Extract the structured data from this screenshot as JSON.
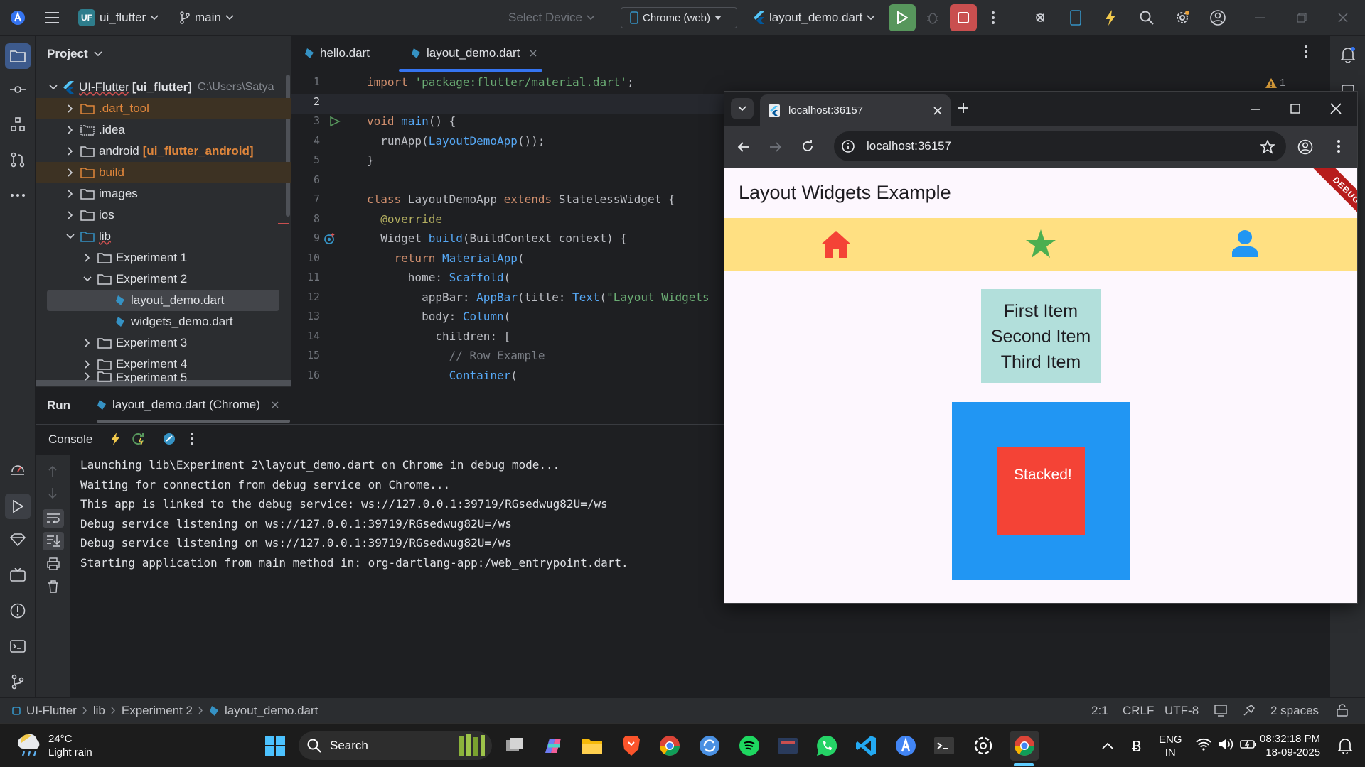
{
  "topbar": {
    "project_badge": "UF",
    "project_name": "ui_flutter",
    "branch": "main",
    "device_placeholder": "Select Device",
    "device_selected": "Chrome (web)",
    "run_config": "layout_demo.dart"
  },
  "project_panel": {
    "title": "Project",
    "root_name": "UI-Flutter",
    "root_module": "[ui_flutter]",
    "root_path": "C:\\Users\\Satya",
    "items": [
      {
        "label": ".dart_tool",
        "suffix": ""
      },
      {
        "label": ".idea",
        "suffix": ""
      },
      {
        "label": "android",
        "suffix": "[ui_flutter_android]"
      },
      {
        "label": "build",
        "suffix": ""
      },
      {
        "label": "images",
        "suffix": ""
      },
      {
        "label": "ios",
        "suffix": ""
      },
      {
        "label": "lib",
        "suffix": ""
      },
      {
        "label": "Experiment 1",
        "suffix": ""
      },
      {
        "label": "Experiment 2",
        "suffix": ""
      },
      {
        "label": "layout_demo.dart",
        "suffix": ""
      },
      {
        "label": "widgets_demo.dart",
        "suffix": ""
      },
      {
        "label": "Experiment 3",
        "suffix": ""
      },
      {
        "label": "Experiment 4",
        "suffix": ""
      },
      {
        "label": "Experiment 5",
        "suffix": ""
      }
    ]
  },
  "editor": {
    "tabs": [
      {
        "label": "hello.dart"
      },
      {
        "label": "layout_demo.dart"
      }
    ],
    "warning_count": "1",
    "line_numbers": [
      "1",
      "2",
      "3",
      "4",
      "5",
      "6",
      "7",
      "8",
      "9",
      "10",
      "11",
      "12",
      "13",
      "14",
      "15",
      "16"
    ],
    "lines": [
      "import 'package:flutter/material.dart';",
      "",
      "void main() {",
      "  runApp(LayoutDemoApp());",
      "}",
      "",
      "class LayoutDemoApp extends StatelessWidget {",
      "  @override",
      "  Widget build(BuildContext context) {",
      "    return MaterialApp(",
      "      home: Scaffold(",
      "        appBar: AppBar(title: Text(\"Layout Widgets",
      "        body: Column(",
      "          children: [",
      "            // Row Example",
      "            Container("
    ]
  },
  "run_panel": {
    "tab_run": "Run",
    "tab_config": "layout_demo.dart (Chrome)",
    "console_label": "Console",
    "console_lines": [
      "Launching lib\\Experiment 2\\layout_demo.dart on Chrome in debug mode...",
      "Waiting for connection from debug service on Chrome...",
      "This app is linked to the debug service: ws://127.0.0.1:39719/RGsedwug82U=/ws",
      "Debug service listening on ws://127.0.0.1:39719/RGsedwug82U=/ws",
      "Debug service listening on ws://127.0.0.1:39719/RGsedwug82U=/ws",
      "Starting application from main method in: org-dartlang-app:/web_entrypoint.dart."
    ]
  },
  "statusbar": {
    "breadcrumb": [
      "UI-Flutter",
      "lib",
      "Experiment 2",
      "layout_demo.dart"
    ],
    "position": "2:1",
    "line_sep": "CRLF",
    "encoding": "UTF-8",
    "indent": "2 spaces"
  },
  "browser": {
    "tab_title": "localhost:36157",
    "url": "localhost:36157"
  },
  "app": {
    "title": "Layout Widgets Example",
    "debug_banner": "DEBUG",
    "column_items": [
      "First Item",
      "Second Item",
      "Third Item"
    ],
    "stack_label": "Stacked!",
    "colors": {
      "row_bg": "#ffe082",
      "home": "#f44336",
      "star": "#4caf50",
      "person": "#2196f3",
      "column_bg": "#b2dfdb",
      "stack_outer": "#2196f3",
      "stack_inner": "#f44336"
    }
  },
  "taskbar": {
    "weather_temp": "24°C",
    "weather_desc": "Light rain",
    "search_placeholder": "Search",
    "lang_top": "ENG",
    "lang_bottom": "IN",
    "time": "08:32:18 PM",
    "date": "18-09-2025"
  }
}
